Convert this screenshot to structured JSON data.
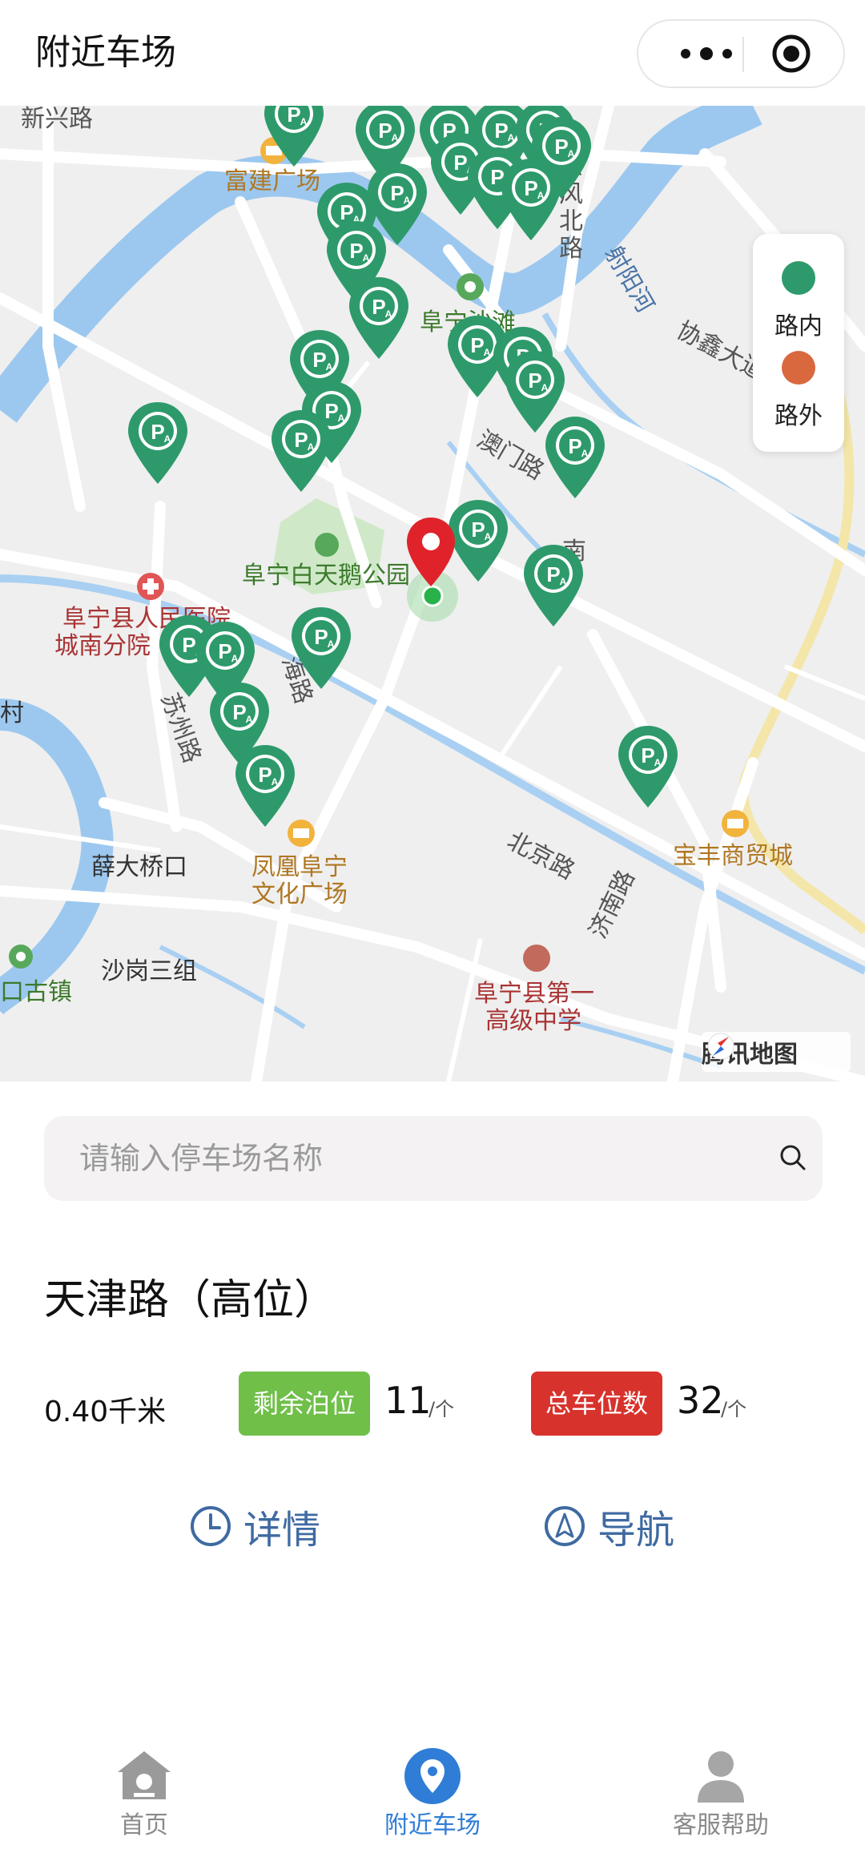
{
  "header": {
    "title": "附近车场",
    "more_icon": "more-dots-icon",
    "close_icon": "target-icon"
  },
  "map": {
    "labels": {
      "fujian_plaza": "富建广场",
      "dongfeng_north": "东风北路",
      "shegu_river": "射阳河",
      "xiexin_avenue": "协鑫大道",
      "fu_beach": "阜宁沙滩",
      "aomen_road": "澳门路",
      "swan_park": "阜宁白天鹅公园",
      "hospital_1": "阜宁县人民医院",
      "hospital_2": "城南分院",
      "suzhou_road": "苏州路",
      "hai_road": "海路",
      "nan": "南",
      "xue_bridge": "薛大桥口",
      "fenghuang_1": "凤凰阜宁",
      "fenghuang_2": "文化广场",
      "beijing_road": "北京路",
      "jinan_road": "济南路",
      "baofeng": "宝丰商贸城",
      "shagang": "沙岗三组",
      "old_town": "口古镇",
      "school_1": "阜宁县第一",
      "school_2": "高级中学",
      "xinxing": "新兴路",
      "cun": "村",
      "provider": "腾讯地图"
    },
    "legend": {
      "on_street": {
        "label": "路内",
        "color": "#2e9a6b"
      },
      "off_street": {
        "label": "路外",
        "color": "#d9683e"
      }
    },
    "marker_icon": "parking-pin-icon",
    "location_icon": "red-location-pin-icon"
  },
  "search": {
    "placeholder": "请输入停车场名称",
    "icon": "search-icon"
  },
  "lot": {
    "name": "天津路（高位）",
    "distance": "0.40千米",
    "remaining_label": "剩余泊位",
    "remaining_value": "11",
    "remaining_unit": "/个",
    "total_label": "总车位数",
    "total_value": "32",
    "total_unit": "/个",
    "green": "#6fbf49",
    "red": "#d8322c"
  },
  "actions": {
    "detail_label": "详情",
    "detail_icon": "clock-icon",
    "navigate_label": "导航",
    "navigate_icon": "navigation-arrow-icon"
  },
  "tabbar": {
    "tabs": [
      {
        "label": "首页",
        "icon": "home-icon",
        "active": false
      },
      {
        "label": "附近车场",
        "icon": "location-pin-icon",
        "active": true
      },
      {
        "label": "客服帮助",
        "icon": "user-icon",
        "active": false
      }
    ],
    "active_color": "#2f7dd7"
  }
}
